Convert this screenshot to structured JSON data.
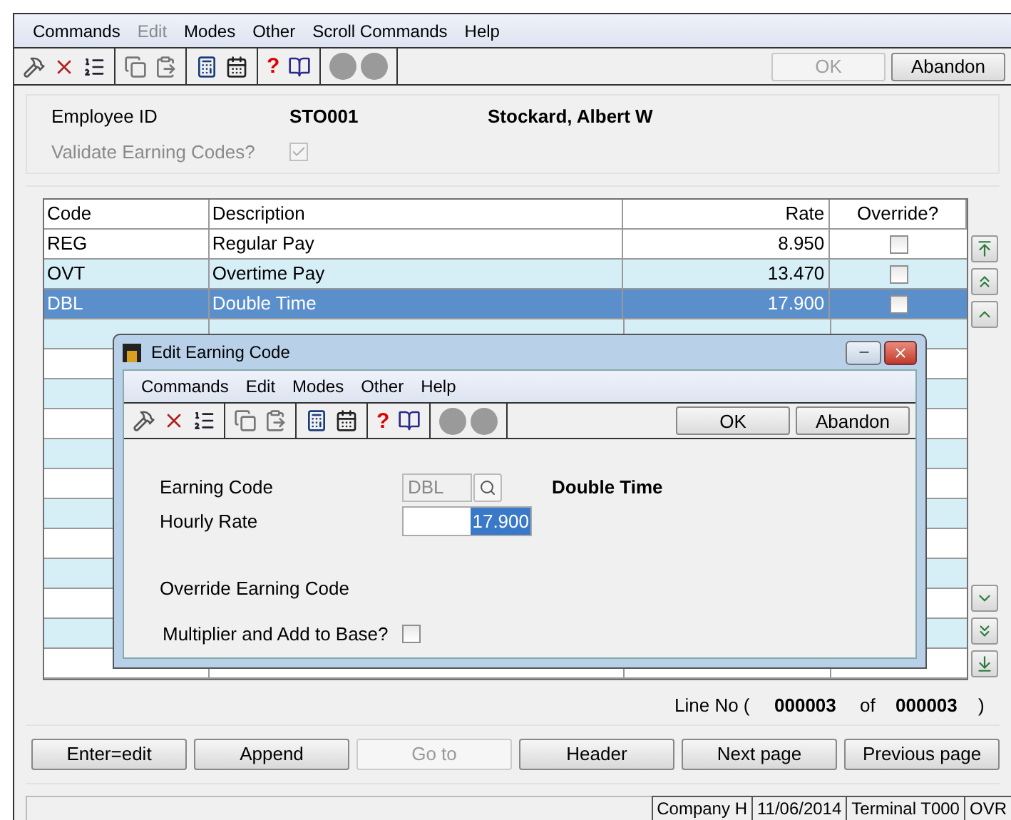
{
  "menu": [
    {
      "label": "Commands",
      "disabled": false
    },
    {
      "label": "Edit",
      "disabled": true
    },
    {
      "label": "Modes",
      "disabled": false
    },
    {
      "label": "Other",
      "disabled": false
    },
    {
      "label": "Scroll Commands",
      "disabled": false
    },
    {
      "label": "Help",
      "disabled": false
    }
  ],
  "toolbar": {
    "help_glyph": "?",
    "buttons": [
      {
        "label": "OK",
        "disabled": true
      },
      {
        "label": "Abandon",
        "disabled": false
      }
    ]
  },
  "header": {
    "employee_id_label": "Employee ID",
    "employee_id": "STO001",
    "employee_name": "Stockard, Albert W",
    "validate_label": "Validate Earning Codes?",
    "validate_checked": true,
    "validate_disabled": true
  },
  "table": {
    "columns": [
      "Code",
      "Description",
      "Rate",
      "Override?"
    ],
    "rows": [
      {
        "code": "REG",
        "description": "Regular Pay",
        "rate": "8.950",
        "override": false,
        "selected": false
      },
      {
        "code": "OVT",
        "description": "Overtime Pay",
        "rate": "13.470",
        "override": false,
        "selected": false
      },
      {
        "code": "DBL",
        "description": "Double Time",
        "rate": "17.900",
        "override": false,
        "selected": true
      }
    ]
  },
  "line_no": {
    "label": "Line No (",
    "current": "000003",
    "of": "of",
    "total": "000003",
    "close": ")"
  },
  "buttons": [
    {
      "label": "Enter=edit",
      "disabled": false
    },
    {
      "label": "Append",
      "disabled": false
    },
    {
      "label": "Go to",
      "disabled": true
    },
    {
      "label": "Header",
      "disabled": false
    },
    {
      "label": "Next page",
      "disabled": false
    },
    {
      "label": "Previous page",
      "disabled": false
    }
  ],
  "status_bar": [
    "Company H",
    "11/06/2014",
    "Terminal T000",
    "OVR"
  ],
  "dialog": {
    "title": "Edit Earning Code",
    "menu": [
      {
        "label": "Commands",
        "disabled": false
      },
      {
        "label": "Edit",
        "disabled": false
      },
      {
        "label": "Modes",
        "disabled": false
      },
      {
        "label": "Other",
        "disabled": false
      },
      {
        "label": "Help",
        "disabled": false
      }
    ],
    "help_glyph": "?",
    "buttons": [
      {
        "label": "OK",
        "disabled": false
      },
      {
        "label": "Abandon",
        "disabled": false
      }
    ],
    "earning_code_label": "Earning Code",
    "earning_code": "DBL",
    "earning_description": "Double Time",
    "hourly_rate_label": "Hourly Rate",
    "hourly_rate": "17.900",
    "hourly_rate_selected": true,
    "override_label": "Override Earning Code",
    "multiplier_label": "Multiplier and Add to Base?",
    "multiplier_checked": false
  }
}
